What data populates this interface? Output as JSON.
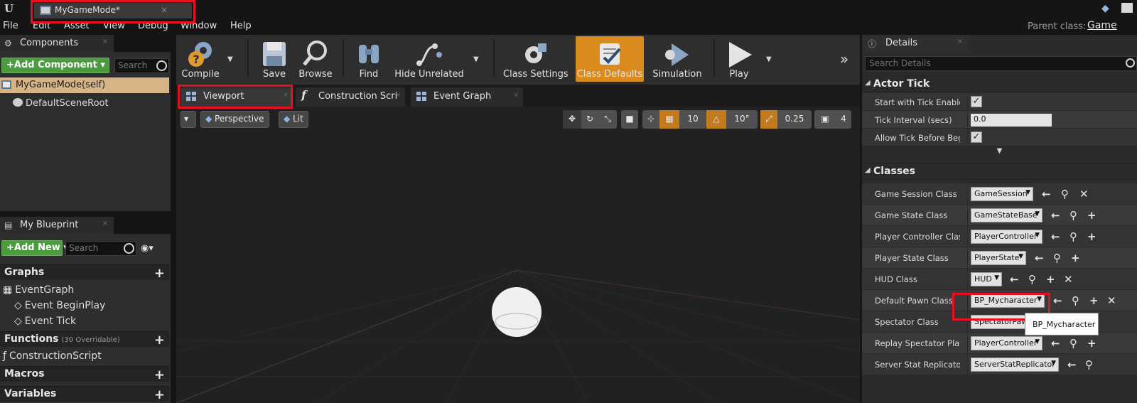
{
  "window": {
    "doc_tab_title": "MyGameMode*",
    "parent_class_label": "Parent class:",
    "parent_class_value": "Game"
  },
  "menu": [
    "File",
    "Edit",
    "Asset",
    "View",
    "Debug",
    "Window",
    "Help"
  ],
  "components": {
    "tab_label": "Components",
    "add_button": "+Add Component ▾",
    "search_placeholder": "Search",
    "items": [
      "MyGameMode(self)",
      "DefaultSceneRoot"
    ]
  },
  "my_blueprint": {
    "tab_label": "My Blueprint",
    "add_new_button": "+Add New ▾",
    "search_placeholder": "Search",
    "sections": {
      "graphs": "Graphs",
      "functions": "Functions",
      "functions_note": "(30 Overridable)",
      "macros": "Macros",
      "variables": "Variables"
    },
    "graph_items": [
      "EventGraph",
      "Event BeginPlay",
      "Event Tick"
    ],
    "function_items": [
      "ConstructionScript"
    ]
  },
  "toolbar": {
    "compile": "Compile",
    "save": "Save",
    "browse": "Browse",
    "find": "Find",
    "hide_unrelated": "Hide Unrelated",
    "class_settings": "Class Settings",
    "class_defaults": "Class Defaults",
    "simulation": "Simulation",
    "play": "Play",
    "more": "»"
  },
  "editor_tabs": [
    "Viewport",
    "Construction Scrip",
    "Event Graph"
  ],
  "viewport": {
    "view_mode": "Perspective",
    "lighting": "Lit",
    "grid_snap": "10",
    "rotation_snap": "10°",
    "scale_snap": "0.25",
    "camera_speed": "4"
  },
  "details": {
    "tab_label": "Details",
    "search_placeholder": "Search Details",
    "actor_tick": {
      "header": "Actor Tick",
      "start_with_tick_enabled": "Start with Tick Enabled",
      "tick_interval_label": "Tick Interval (secs)",
      "tick_interval_value": "0.0",
      "allow_tick_before_begin_play": "Allow Tick Before Begin Pl"
    },
    "classes": {
      "header": "Classes",
      "rows": [
        {
          "label": "Game Session Class",
          "value": "GameSession"
        },
        {
          "label": "Game State Class",
          "value": "GameStateBase"
        },
        {
          "label": "Player Controller Class",
          "value": "PlayerController"
        },
        {
          "label": "Player State Class",
          "value": "PlayerState"
        },
        {
          "label": "HUD Class",
          "value": "HUD"
        },
        {
          "label": "Default Pawn Class",
          "value": "BP_Mycharacter"
        },
        {
          "label": "Spectator Class",
          "value": "SpectatorPaw"
        },
        {
          "label": "Replay Spectator Player C",
          "value": "PlayerController"
        },
        {
          "label": "Server Stat Replicator Clas",
          "value": "ServerStatReplicator"
        }
      ]
    },
    "tooltip": "BP_Mycharacter"
  },
  "colors": {
    "highlight": "#e8101f",
    "active_toolbar": "#d98c1d",
    "add_green": "#4c9b3e",
    "selected_row": "#d6b486"
  }
}
